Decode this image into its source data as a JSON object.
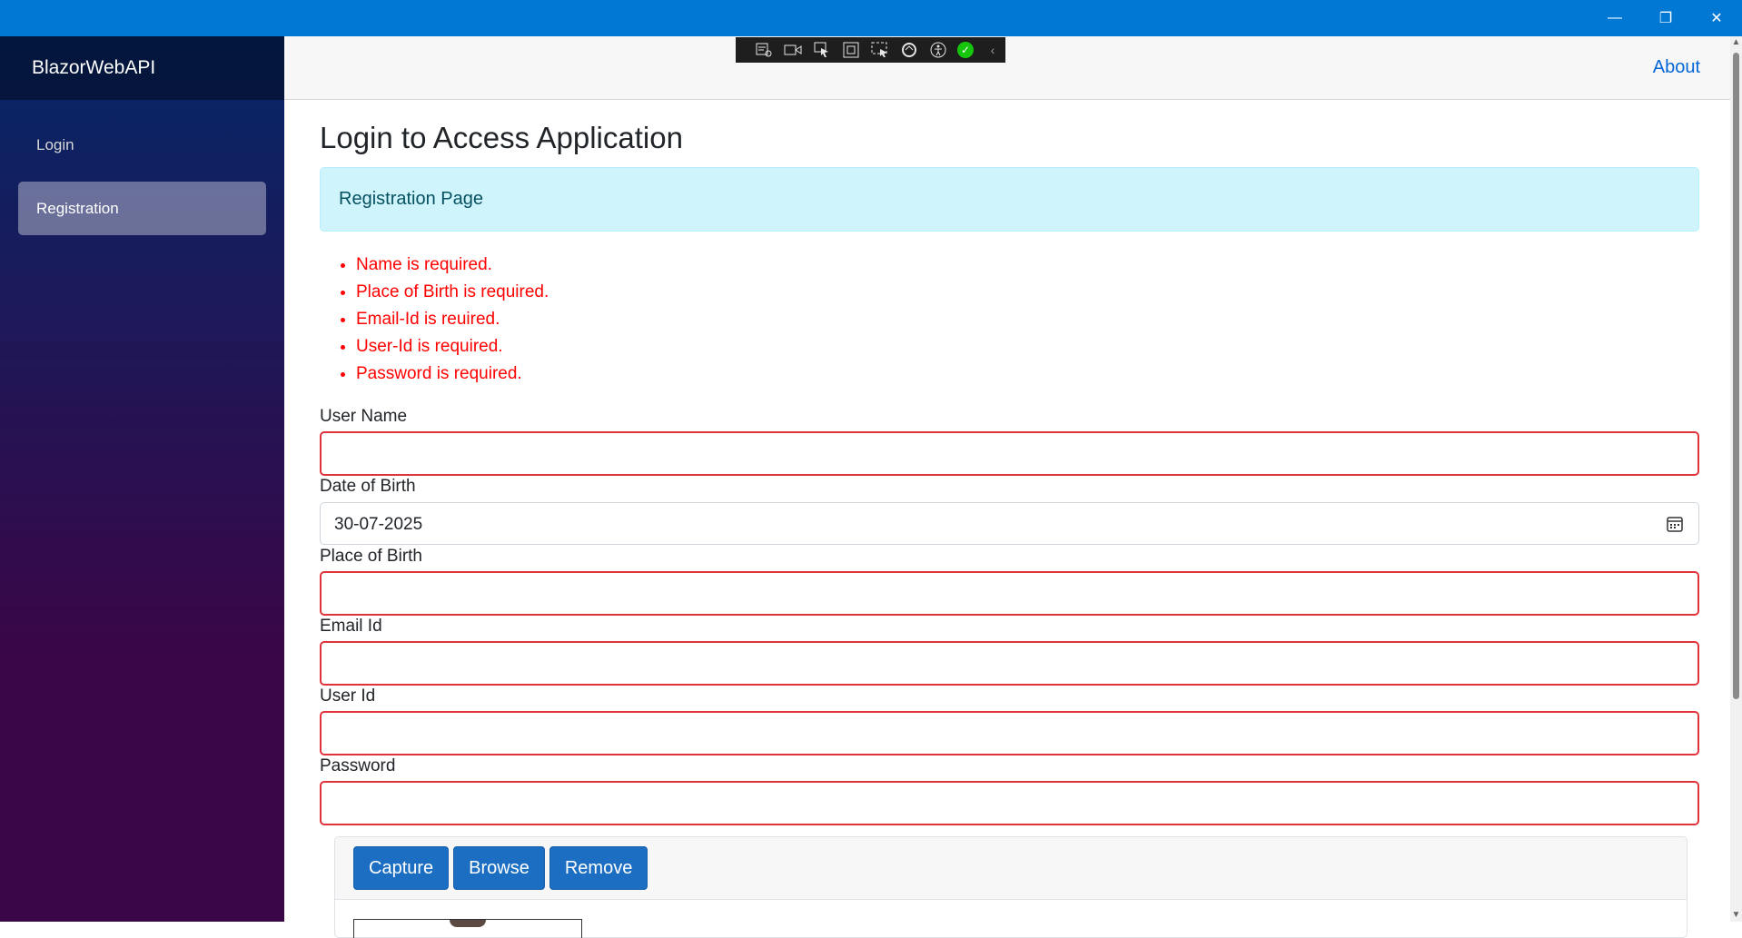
{
  "window": {
    "controls": [
      {
        "name": "minimize",
        "glyph": "—"
      },
      {
        "name": "restore",
        "glyph": "❐"
      },
      {
        "name": "close",
        "glyph": "✕"
      }
    ]
  },
  "sidebar": {
    "brand": "BlazorWebAPI",
    "items": [
      {
        "label": "Login",
        "active": false
      },
      {
        "label": "Registration",
        "active": true
      }
    ]
  },
  "top_row": {
    "about_label": "About"
  },
  "devtools_toolbar": {
    "icons": [
      "live-visual-tree-icon",
      "record-icon",
      "select-element-icon",
      "display-layout-adorners-icon",
      "track-focus-icon",
      "hot-reload-icon",
      "accessibility-icon",
      "status-ok-icon",
      "collapse-chevron-icon"
    ]
  },
  "page": {
    "title": "Login to Access Application",
    "alert": "Registration Page",
    "validation_errors": [
      "Name is required.",
      "Place of Birth is required.",
      "Email-Id is reuired.",
      "User-Id is required.",
      "Password is required."
    ],
    "fields": {
      "user_name": {
        "label": "User Name",
        "value": ""
      },
      "date_of_birth": {
        "label": "Date of Birth",
        "value": "30-07-2025"
      },
      "place_of_birth": {
        "label": "Place of Birth",
        "value": ""
      },
      "email_id": {
        "label": "Email Id",
        "value": ""
      },
      "user_id": {
        "label": "User Id",
        "value": ""
      },
      "password": {
        "label": "Password",
        "value": ""
      }
    },
    "photo_buttons": {
      "capture": "Capture",
      "browse": "Browse",
      "remove": "Remove"
    }
  },
  "colors": {
    "titlebar": "#0078d4",
    "accent_button": "#1b6ec2",
    "error": "#ff0000",
    "alert_bg": "#cff4fc",
    "link": "#0366d6"
  }
}
